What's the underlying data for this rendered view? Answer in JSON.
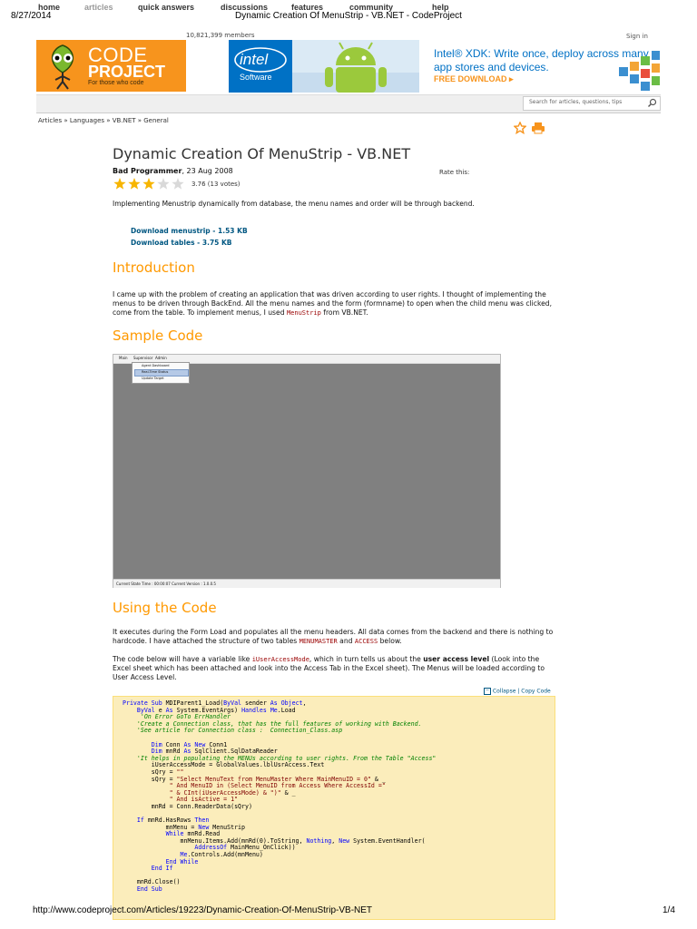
{
  "print": {
    "date": "8/27/2014",
    "title": "Dynamic Creation Of MenuStrip - VB.NET - CodeProject",
    "url": "http://www.codeproject.com/Articles/19223/Dynamic-Creation-Of-MenuStrip-VB-NET",
    "page": "1/4"
  },
  "header": {
    "members": "10,821,399 members",
    "signin": "Sign in",
    "logo": {
      "line1": "CODE",
      "line2": "PROJECT",
      "tagline": "For those who code"
    },
    "ad": {
      "brand": "intel",
      "product": "Software",
      "headline": "Intel® XDK: Write once, deploy across many app stores and devices.",
      "cta": "FREE DOWNLOAD ▸"
    }
  },
  "nav": {
    "items": [
      "home",
      "articles",
      "quick answers",
      "discussions",
      "features",
      "community",
      "help"
    ],
    "active": "articles",
    "search_placeholder": "Search for articles, questions, tips"
  },
  "breadcrumb": "Articles » Languages » VB.NET » General",
  "article": {
    "title": "Dynamic Creation Of MenuStrip - VB.NET",
    "author": "Bad Programmer",
    "date": ", 23 Aug 2008",
    "rate_label": "Rate this:",
    "rating_value": 3.76,
    "rating_text": "3.76 (13 votes)",
    "summary": "Implementing Menustrip dynamically from database, the menu names and order will be through backend.",
    "downloads": [
      "Download menustrip - 1.53 KB",
      "Download tables - 3.75 KB"
    ],
    "intro_heading": "Introduction",
    "intro_p1": "I came up with the problem of creating an application that was driven according to user rights. I thought of implementing the menus to be driven through BackEnd. All the menu names and the form (formname) to open when the child menu was clicked, come from the table. To implement menus, I used ",
    "intro_code": "MenuStrip",
    "intro_p2": " from VB.NET.",
    "sample_heading": "Sample Code",
    "figure": {
      "menus": [
        "Main",
        "Supervisor",
        "Admin"
      ],
      "dropdown": [
        "Agent Dashboard",
        "Real-Time Status",
        "Update Target"
      ],
      "status": "Current State Time :  00:00:07  Current Version :  1.0.0.5"
    },
    "using_heading": "Using the Code",
    "using_p1": "It executes during the Form Load and populates all the menu headers. All data comes from the backend and there is nothing to hardcode. I have attached the structure of two tables ",
    "using_t1": "MENUMASTER",
    "using_and": " and ",
    "using_t2": "ACCESS",
    "using_below": " below.",
    "using_p2a": "The code below will have a variable like ",
    "using_var": "iUserAccessMode",
    "using_p2b": ", which in turn tells us about the ",
    "using_bold": "user access level",
    "using_p2c": " (Look into the Excel sheet which has been attached and look into the Access Tab in the Excel sheet). The Menus will be loaded according to User Access Level.",
    "code_tools": "Collapse | Copy Code"
  }
}
